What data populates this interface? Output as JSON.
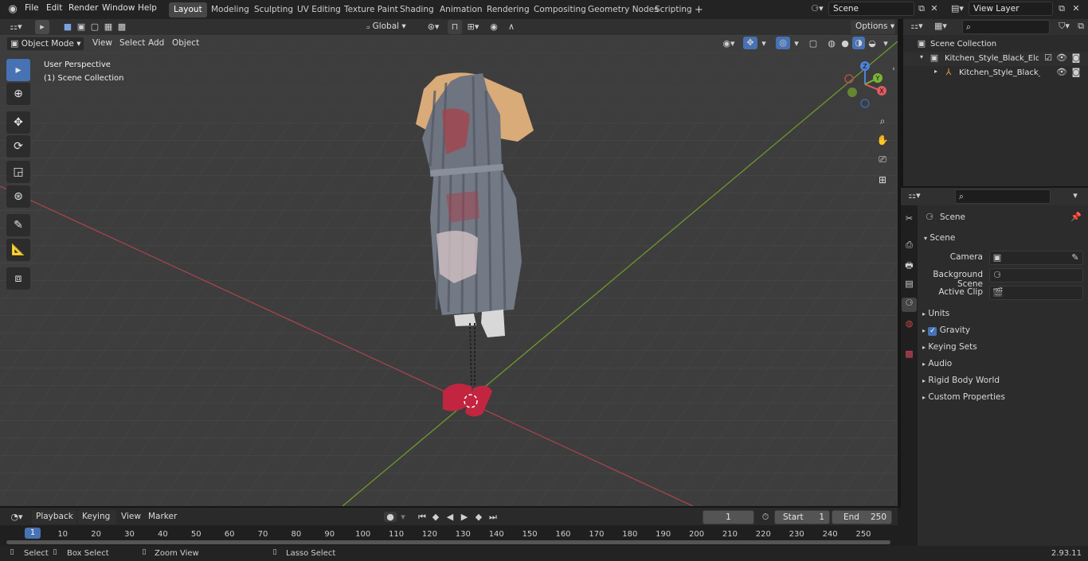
{
  "topbar": {
    "menus": [
      "File",
      "Edit",
      "Render",
      "Window",
      "Help"
    ],
    "workspaces": [
      "Layout",
      "Modeling",
      "Sculpting",
      "UV Editing",
      "Texture Paint",
      "Shading",
      "Animation",
      "Rendering",
      "Compositing",
      "Geometry Nodes",
      "Scripting"
    ],
    "add_tab": "+",
    "scene_label": "Scene",
    "view_layer_label": "View Layer"
  },
  "viewport_header": {
    "transform_orientation": "Global",
    "options_label": "Options",
    "mode": "Object Mode",
    "menus": [
      "View",
      "Select",
      "Add",
      "Object"
    ]
  },
  "viewport": {
    "perspective_label": "User Perspective",
    "collection_label": "(1) Scene Collection",
    "gizmo_axes": {
      "x": "X",
      "y": "Y",
      "z": "Z"
    }
  },
  "outliner": {
    "root": "Scene Collection",
    "items": [
      {
        "label": "Kitchen_Style_Black_Elderly_W"
      },
      {
        "label": "Kitchen_Style_Black_Elde"
      }
    ]
  },
  "properties": {
    "header_title": "Scene",
    "section_title": "Scene",
    "fields": [
      {
        "label": "Camera",
        "value": ""
      },
      {
        "label": "Background Scene",
        "value": ""
      },
      {
        "label": "Active Clip",
        "value": ""
      }
    ],
    "panels": [
      "Units",
      "Gravity",
      "Keying Sets",
      "Audio",
      "Rigid Body World",
      "Custom Properties"
    ],
    "gravity_checked": true
  },
  "timeline": {
    "menus": [
      "Playback",
      "Keying",
      "View",
      "Marker"
    ],
    "current_frame": "1",
    "start_label": "Start",
    "start_value": "1",
    "end_label": "End",
    "end_value": "250",
    "ticks": [
      "1",
      "10",
      "20",
      "30",
      "40",
      "50",
      "60",
      "70",
      "80",
      "90",
      "100",
      "110",
      "120",
      "130",
      "140",
      "150",
      "160",
      "170",
      "180",
      "190",
      "200",
      "210",
      "220",
      "230",
      "240",
      "250"
    ]
  },
  "statusbar": {
    "items": [
      "Select",
      "Box Select",
      "Zoom View",
      "Lasso Select"
    ],
    "version": "2.93.11"
  },
  "colors": {
    "accent": "#4772b3",
    "x_axis": "#b3474f",
    "y_axis": "#6a9c2a",
    "viewport_bg": "#3d3d3d"
  }
}
